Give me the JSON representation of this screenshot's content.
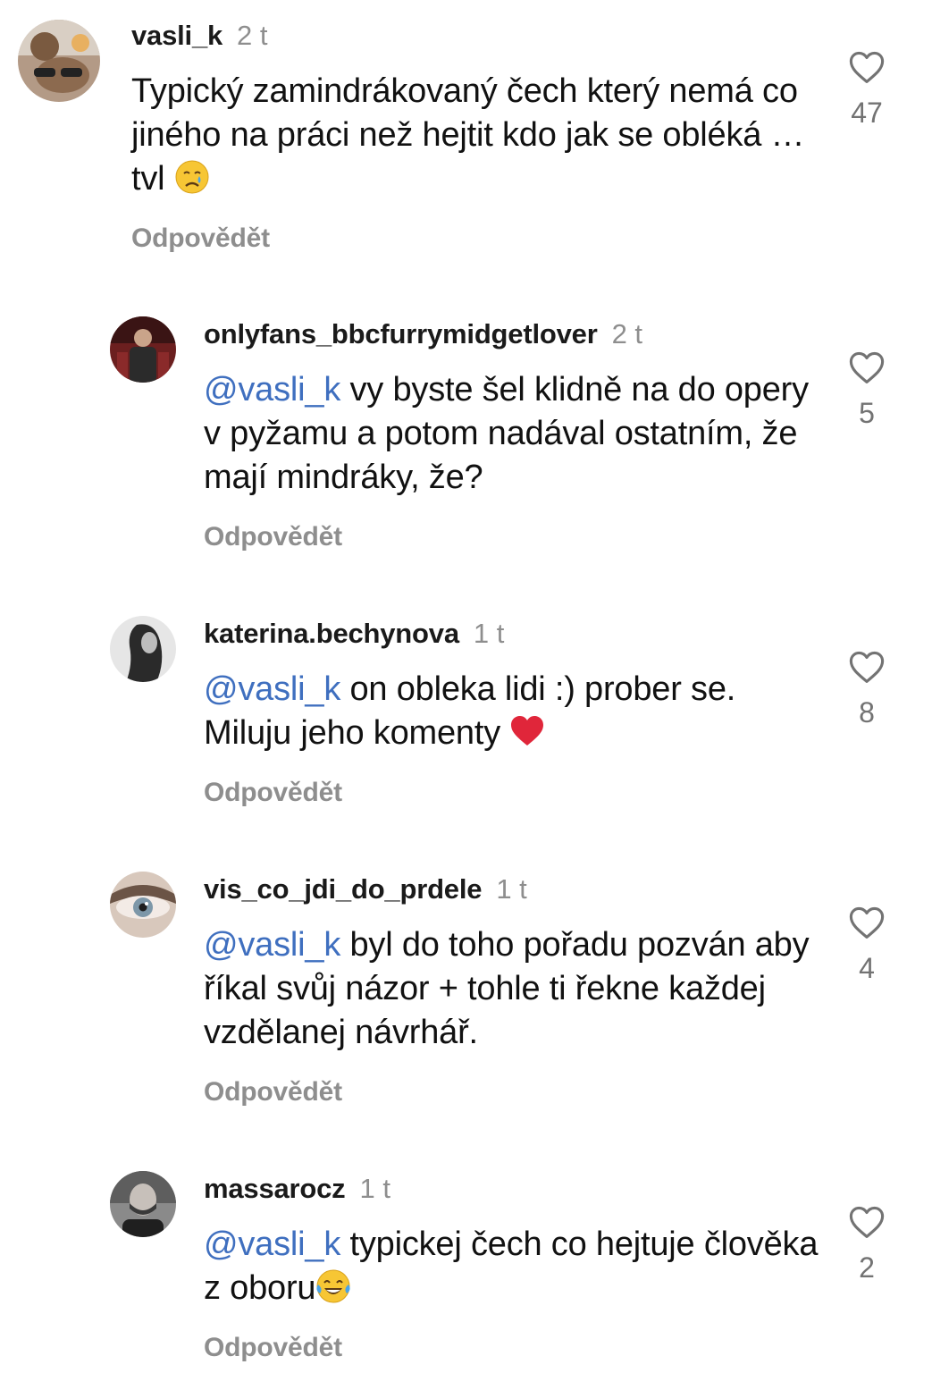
{
  "comments": [
    {
      "username": "vasli_k",
      "time": "2 t",
      "mention": "",
      "text": "Typický zamindrákovaný čech který nemá co jiného na práci než hejtit kdo jak se obléká …tvl ",
      "emoji": "crying-face",
      "reply_label": "Odpovědět",
      "likes": "47"
    },
    {
      "username": "onlyfans_bbcfurrymidgetlover",
      "time": "2 t",
      "mention": "@vasli_k",
      "text": " vy byste šel klidně na do opery v pyžamu a potom nadával ostatním, že mají mindráky, že?",
      "emoji": "",
      "reply_label": "Odpovědět",
      "likes": "5"
    },
    {
      "username": "katerina.bechynova",
      "time": "1 t",
      "mention": "@vasli_k",
      "text": " on obleka lidi :) prober se. Miluju jeho komenty ",
      "emoji": "red-heart",
      "reply_label": "Odpovědět",
      "likes": "8"
    },
    {
      "username": "vis_co_jdi_do_prdele",
      "time": "1 t",
      "mention": "@vasli_k",
      "text": " byl do toho pořadu pozván aby říkal svůj názor + tohle ti řekne každej vzdělanej návrhář.",
      "emoji": "",
      "reply_label": "Odpovědět",
      "likes": "4"
    },
    {
      "username": "massarocz",
      "time": "1 t",
      "mention": "@vasli_k",
      "text": " typickej čech co hejtuje člověka z oboru",
      "emoji": "face-with-tears-of-joy",
      "reply_label": "Odpovědět",
      "likes": "2"
    }
  ],
  "colors": {
    "mention": "#3f6fbf",
    "secondary_text": "#8e8e8e",
    "like_icon": "#737373"
  }
}
